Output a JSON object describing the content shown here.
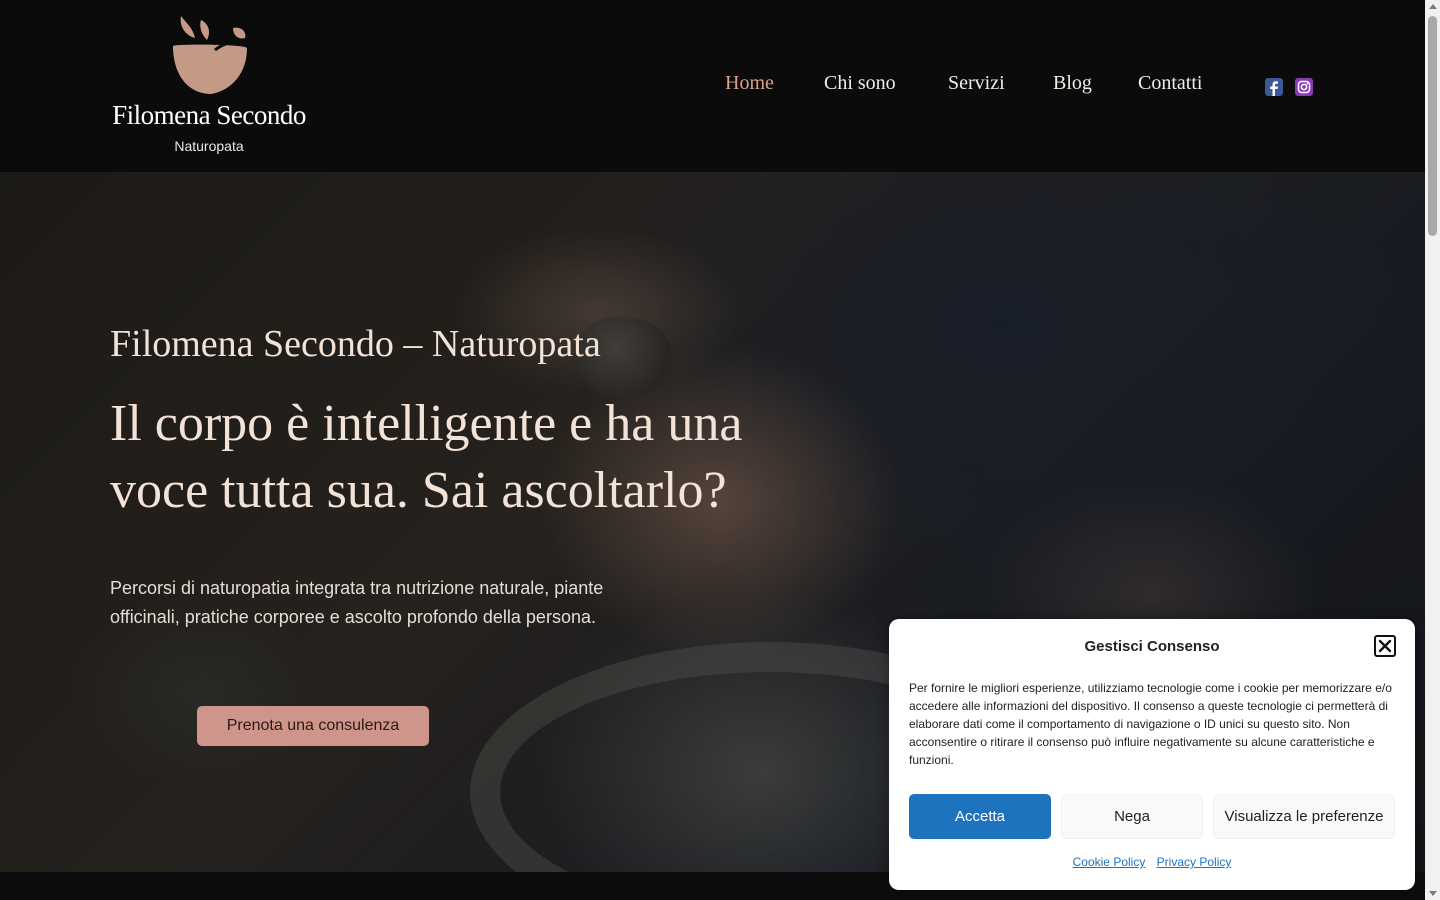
{
  "brand": {
    "name": "Filomena Secondo",
    "tagline": "Naturopata",
    "logo_icon": "mortar-and-leaves-logo",
    "logo_color": "#c49a86"
  },
  "nav": {
    "items": [
      {
        "label": "Home",
        "active": true
      },
      {
        "label": "Chi sono",
        "active": false
      },
      {
        "label": "Servizi",
        "active": false
      },
      {
        "label": "Blog",
        "active": false
      },
      {
        "label": "Contatti",
        "active": false
      }
    ],
    "active_color": "#d7a28f",
    "social": [
      {
        "icon": "facebook-icon",
        "color": "#3b5998"
      },
      {
        "icon": "instagram-icon",
        "color": "#8a3ab9"
      }
    ]
  },
  "hero": {
    "subtitle": "Filomena Secondo – Naturopata",
    "title": "Il corpo è intelligente e ha una voce tutta sua. Sai ascoltarlo?",
    "text": "Percorsi di naturopatia integrata tra nutrizione naturale, piante officinali, pratiche corporee e ascolto profondo della persona.",
    "cta_label": "Prenota una consulenza",
    "cta_color": "#cf958a"
  },
  "consent": {
    "title": "Gestisci Consenso",
    "text": "Per fornire le migliori esperienze, utilizziamo tecnologie come i cookie per memorizzare e/o accedere alle informazioni del dispositivo. Il consenso a queste tecnologie ci permetterà di elaborare dati come il comportamento di navigazione o ID unici su questo sito. Non acconsentire o ritirare il consenso può influire negativamente su alcune caratteristiche e funzioni.",
    "accept_label": "Accetta",
    "deny_label": "Nega",
    "prefs_label": "Visualizza le preferenze",
    "cookie_policy_label": "Cookie Policy",
    "privacy_policy_label": "Privacy Policy",
    "accent_color": "#1e73be"
  }
}
